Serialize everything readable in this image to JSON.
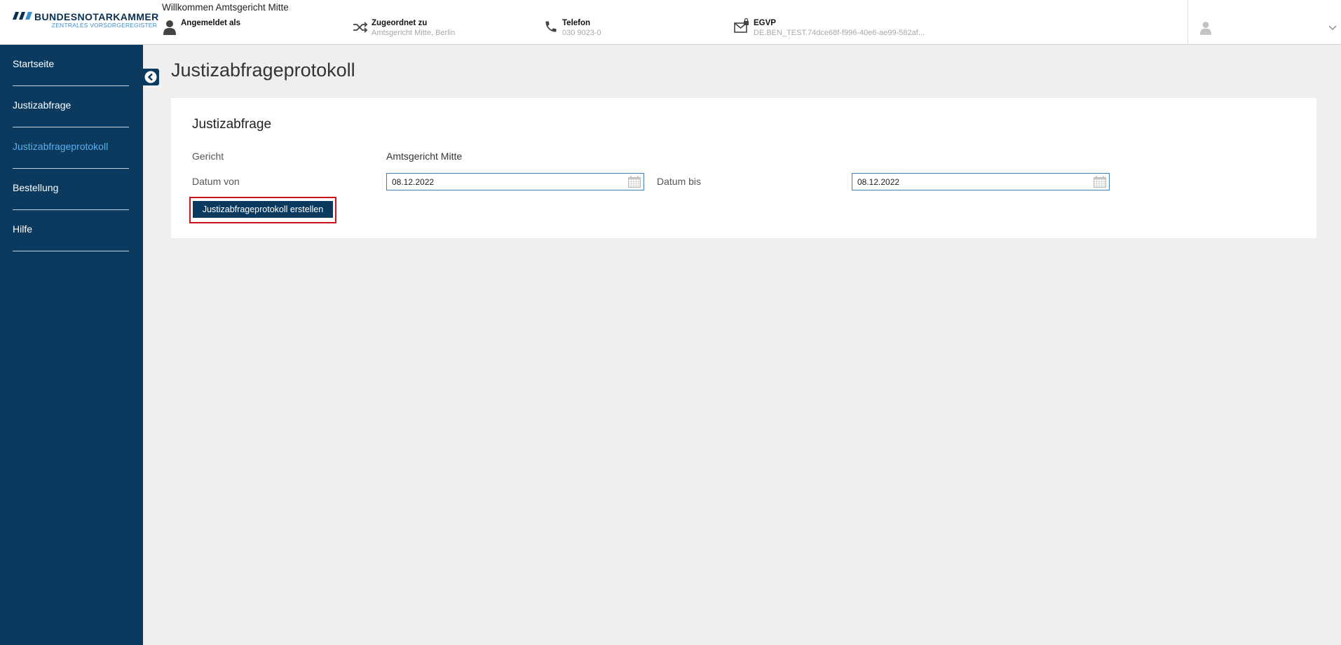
{
  "header": {
    "logo_main": "BUNDESNOTARKAMMER",
    "logo_sub": "ZENTRALES VORSORGEREGISTER",
    "welcome": "Willkommen Amtsgericht Mitte",
    "logged_in_label": "Angemeldet als",
    "assigned_label": "Zugeordnet zu",
    "assigned_value": "Amtsgericht Mitte, Berlin",
    "phone_label": "Telefon",
    "phone_value": "030 9023-0",
    "egvp_label": "EGVP",
    "egvp_value": "DE.BEN_TEST.74dce68f-f996-40e6-ae99-582af..."
  },
  "sidebar": {
    "items": [
      {
        "label": "Startseite"
      },
      {
        "label": "Justizabfrage"
      },
      {
        "label": "Justizabfrageprotokoll"
      },
      {
        "label": "Bestellung"
      },
      {
        "label": "Hilfe"
      }
    ],
    "active_index": 2
  },
  "main": {
    "page_title": "Justizabfrageprotokoll",
    "card_title": "Justizabfrage",
    "court_label": "Gericht",
    "court_value": "Amtsgericht Mitte",
    "date_from_label": "Datum von",
    "date_from_value": "08.12.2022",
    "date_to_label": "Datum bis",
    "date_to_value": "08.12.2022",
    "submit_label": "Justizabfrageprotokoll erstellen"
  },
  "colors": {
    "brand_navy": "#0b3a5e",
    "active_link": "#5ab0ee",
    "highlight_border": "#c8141c",
    "input_border": "#3c7fbe"
  },
  "icons": [
    "user-icon",
    "shuffle-icon",
    "phone-icon",
    "mail-lock-icon",
    "avatar-icon",
    "chevron-down-icon",
    "chevron-left-icon",
    "calendar-icon"
  ]
}
